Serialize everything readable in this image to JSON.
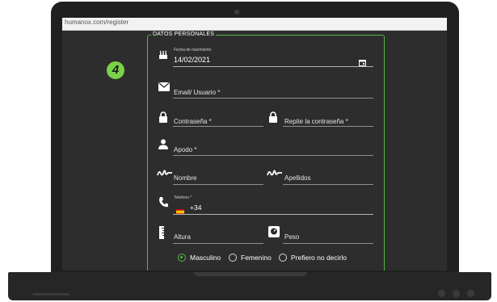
{
  "browser": {
    "url": "humanox.com/register"
  },
  "step_badge": "4",
  "section_title": "DATOS PERSONALES",
  "fields": {
    "birthdate": {
      "label": "Fecha de nacimiento",
      "value": "14/02/2021",
      "icon": "cake-icon"
    },
    "email": {
      "placeholder": "Email/ Usuario *",
      "icon": "envelope-icon"
    },
    "password": {
      "placeholder": "Contraseña *",
      "icon": "lock-icon"
    },
    "password_repeat": {
      "placeholder": "Repite la contraseña *",
      "icon": "lock-icon"
    },
    "nickname": {
      "placeholder": "Apodo *",
      "icon": "person-icon"
    },
    "first_name": {
      "placeholder": "Nombre",
      "icon": "signature-icon"
    },
    "last_name": {
      "placeholder": "Apellidos",
      "icon": "signature-icon"
    },
    "phone": {
      "label": "Telefono *",
      "prefix": "+34",
      "icon": "phone-icon",
      "flag": "spain-flag-icon"
    },
    "height": {
      "placeholder": "Altura",
      "icon": "ruler-icon"
    },
    "weight": {
      "placeholder": "Peso",
      "icon": "scale-icon"
    }
  },
  "gender": {
    "options": [
      "Masculino",
      "Femenino",
      "Prefiero no decirlo"
    ],
    "selected": "Masculino"
  },
  "colors": {
    "accent": "#53b844",
    "badge": "#7ad14a",
    "background": "#2d2d2d"
  }
}
